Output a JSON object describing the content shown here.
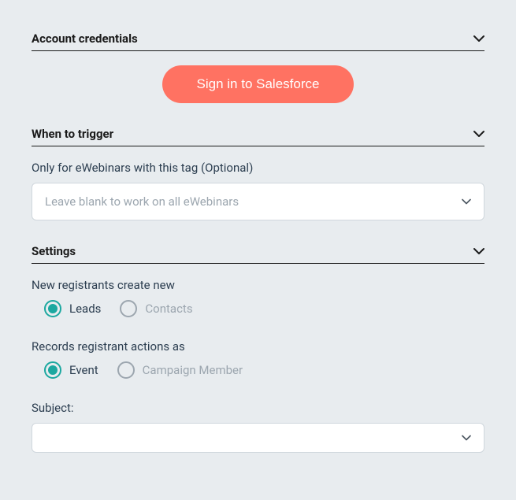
{
  "sections": {
    "account": {
      "title": "Account credentials",
      "signin_label": "Sign in to Salesforce"
    },
    "trigger": {
      "title": "When to trigger",
      "tag_label": "Only for eWebinars with this tag (Optional)",
      "tag_placeholder": "Leave blank to work on all eWebinars"
    },
    "settings": {
      "title": "Settings",
      "registrants_label": "New registrants create new",
      "registrants_options": {
        "leads": "Leads",
        "contacts": "Contacts"
      },
      "records_label": "Records registrant actions as",
      "records_options": {
        "event": "Event",
        "campaign": "Campaign Member"
      },
      "subject_label": "Subject:"
    }
  }
}
